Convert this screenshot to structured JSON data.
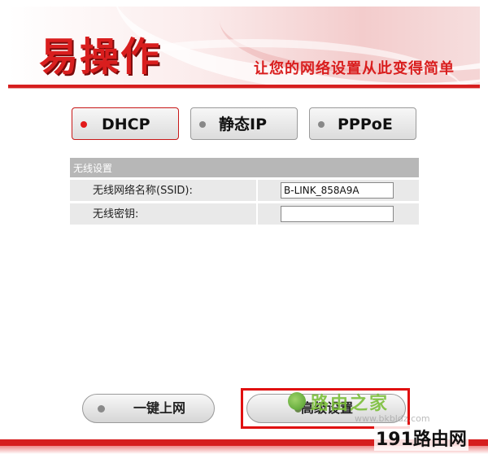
{
  "header": {
    "logo_text": "易操作",
    "slogan": "让您的网络设置从此变得简单"
  },
  "modes": {
    "dhcp": "DHCP",
    "static_ip": "静态IP",
    "pppoe": "PPPoE",
    "selected": "DHCP"
  },
  "wireless": {
    "section_title": "无线设置",
    "ssid_label": "无线网络名称(SSID):",
    "ssid_value": "B-LINK_858A9A",
    "key_label": "无线密钥:",
    "key_value": ""
  },
  "actions": {
    "one_click": "一键上网",
    "advanced": "高级设置"
  },
  "watermark": {
    "title": "路由之家",
    "url": "www.bkbldz.com",
    "brand": "191路由网"
  },
  "colors": {
    "accent": "#d61e1e",
    "highlight": "#e01010"
  }
}
